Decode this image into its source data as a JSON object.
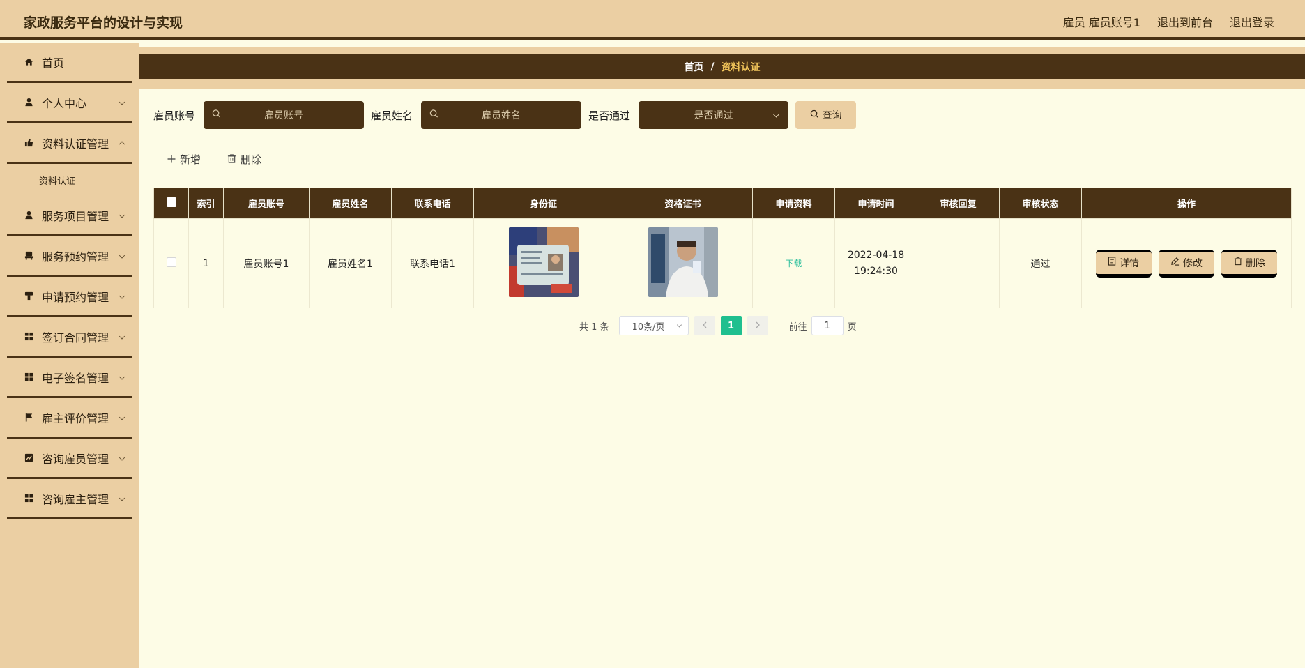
{
  "header": {
    "title": "家政服务平台的设计与实现",
    "user": "雇员 雇员账号1",
    "to_front": "退出到前台",
    "logout": "退出登录"
  },
  "sidebar": {
    "items": [
      {
        "label": "首页",
        "icon": "home-icon"
      },
      {
        "label": "个人中心",
        "icon": "user-icon"
      },
      {
        "label": "资料认证管理",
        "icon": "thumb-icon"
      },
      {
        "label": "资料认证",
        "icon": ""
      },
      {
        "label": "服务项目管理",
        "icon": "user-icon"
      },
      {
        "label": "服务预约管理",
        "icon": "chair-icon"
      },
      {
        "label": "申请预约管理",
        "icon": "flask-icon"
      },
      {
        "label": "签订合同管理",
        "icon": "grid-icon"
      },
      {
        "label": "电子签名管理",
        "icon": "grid-icon"
      },
      {
        "label": "雇主评价管理",
        "icon": "flag-icon"
      },
      {
        "label": "咨询雇员管理",
        "icon": "chart-icon"
      },
      {
        "label": "咨询雇主管理",
        "icon": "grid-icon"
      }
    ]
  },
  "breadcrumb": {
    "home": "首页",
    "sep": "/",
    "current": "资料认证"
  },
  "search": {
    "account_label": "雇员账号",
    "account_placeholder": "雇员账号",
    "name_label": "雇员姓名",
    "name_placeholder": "雇员姓名",
    "pass_label": "是否通过",
    "pass_placeholder": "是否通过",
    "query": "查询"
  },
  "actions": {
    "add": "新增",
    "delete": "删除"
  },
  "table": {
    "headers": [
      "索引",
      "雇员账号",
      "雇员姓名",
      "联系电话",
      "身份证",
      "资格证书",
      "申请资料",
      "申请时间",
      "审核回复",
      "审核状态",
      "操作"
    ],
    "rows": [
      {
        "index": "1",
        "account": "雇员账号1",
        "name": "雇员姓名1",
        "phone": "联系电话1",
        "material": "下载",
        "time": "2022-04-18 19:24:30",
        "reply": "",
        "status": "通过"
      }
    ],
    "ops": {
      "detail": "详情",
      "edit": "修改",
      "delete": "删除"
    }
  },
  "pagination": {
    "total": "共 1 条",
    "page_size": "10条/页",
    "current": "1",
    "goto_label": "前往",
    "goto_value": "1",
    "page_suffix": "页"
  },
  "colors": {
    "brown": "#4a3215",
    "tan": "#ebcfa3",
    "cream": "#fdfce6",
    "accent_green": "#1fbf8f"
  }
}
